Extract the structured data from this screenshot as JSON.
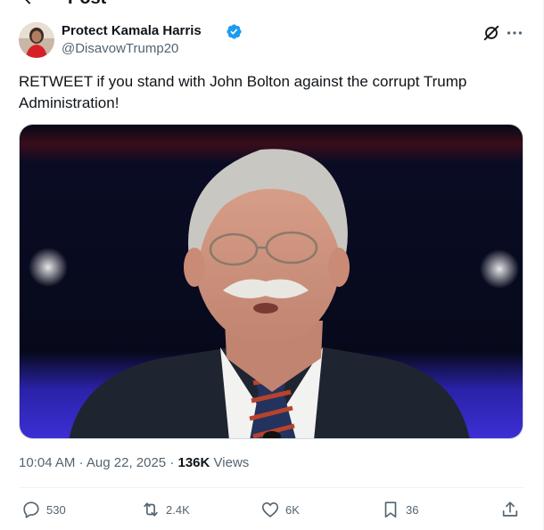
{
  "header": {
    "title": "Post"
  },
  "author": {
    "display_name": "Protect Kamala Harris",
    "handle": "@DisavowTrump20",
    "verified": true
  },
  "tweet": {
    "text": "RETWEET if you stand with John Bolton against the corrupt Trump Administration!"
  },
  "meta": {
    "time": "10:04 AM",
    "date": "Aug 22, 2025",
    "separator": "·",
    "views_count": "136K",
    "views_label": "Views"
  },
  "actions": {
    "replies": "530",
    "reposts": "2.4K",
    "likes": "6K",
    "bookmarks": "36"
  },
  "colors": {
    "verified_blue": "#1d9bf0",
    "secondary_text": "#536471",
    "primary_text": "#0f1419"
  }
}
